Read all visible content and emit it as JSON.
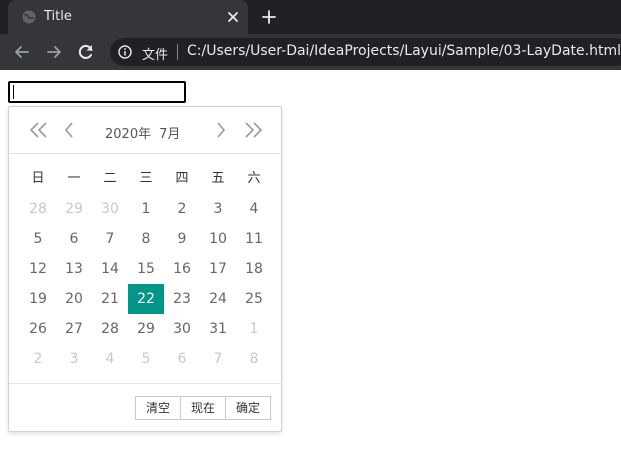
{
  "browser": {
    "tab_title": "Title",
    "scheme_label": "文件",
    "url": "C:/Users/User-Dai/IdeaProjects/Layui/Sample/03-LayDate.html"
  },
  "icons": {
    "favicon": "globe-icon",
    "tab_close": "close-icon",
    "new_tab": "plus-icon",
    "back": "arrow-left-icon",
    "forward": "arrow-right-icon",
    "reload": "reload-icon",
    "info": "info-icon"
  },
  "page": {
    "input_value": ""
  },
  "laydate": {
    "year": "2020年",
    "month": "7月",
    "weekdays": [
      "日",
      "一",
      "二",
      "三",
      "四",
      "五",
      "六"
    ],
    "weeks": [
      [
        {
          "d": "28",
          "other": true
        },
        {
          "d": "29",
          "other": true
        },
        {
          "d": "30",
          "other": true
        },
        {
          "d": "1"
        },
        {
          "d": "2"
        },
        {
          "d": "3"
        },
        {
          "d": "4"
        }
      ],
      [
        {
          "d": "5"
        },
        {
          "d": "6"
        },
        {
          "d": "7"
        },
        {
          "d": "8"
        },
        {
          "d": "9"
        },
        {
          "d": "10"
        },
        {
          "d": "11"
        }
      ],
      [
        {
          "d": "12"
        },
        {
          "d": "13"
        },
        {
          "d": "14"
        },
        {
          "d": "15"
        },
        {
          "d": "16"
        },
        {
          "d": "17"
        },
        {
          "d": "18"
        }
      ],
      [
        {
          "d": "19"
        },
        {
          "d": "20"
        },
        {
          "d": "21"
        },
        {
          "d": "22",
          "selected": true
        },
        {
          "d": "23"
        },
        {
          "d": "24"
        },
        {
          "d": "25"
        }
      ],
      [
        {
          "d": "26"
        },
        {
          "d": "27"
        },
        {
          "d": "28"
        },
        {
          "d": "29"
        },
        {
          "d": "30"
        },
        {
          "d": "31"
        },
        {
          "d": "1",
          "other": true
        }
      ],
      [
        {
          "d": "2",
          "other": true
        },
        {
          "d": "3",
          "other": true
        },
        {
          "d": "4",
          "other": true
        },
        {
          "d": "5",
          "other": true
        },
        {
          "d": "6",
          "other": true
        },
        {
          "d": "7",
          "other": true
        },
        {
          "d": "8",
          "other": true
        }
      ]
    ],
    "buttons": {
      "clear": "清空",
      "now": "现在",
      "confirm": "确定"
    },
    "accent_color": "#009688"
  }
}
